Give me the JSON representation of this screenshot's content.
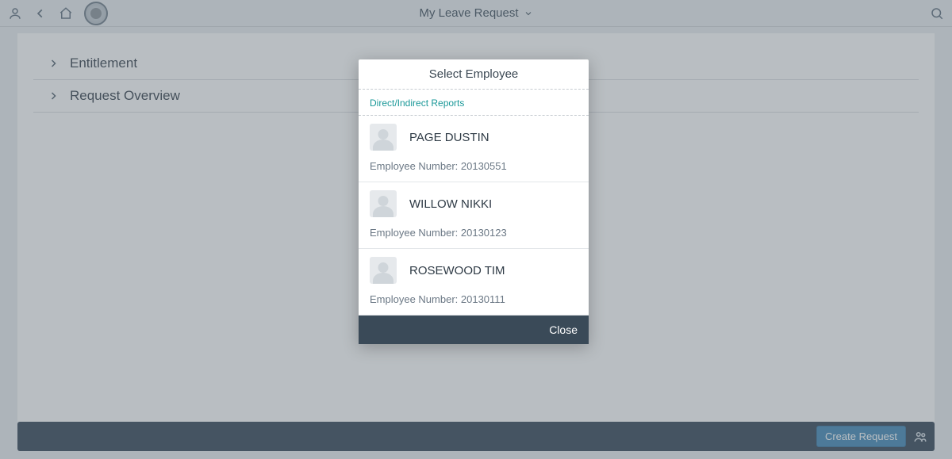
{
  "header": {
    "title": "My Leave Request"
  },
  "accordion": {
    "items": [
      {
        "label": "Entitlement"
      },
      {
        "label": "Request Overview"
      }
    ]
  },
  "footer": {
    "create_label": "Create Request"
  },
  "dialog": {
    "title": "Select Employee",
    "subheader": "Direct/Indirect Reports",
    "emp_number_prefix": "Employee Number: ",
    "employees": [
      {
        "name": "PAGE DUSTIN",
        "number": "20130551"
      },
      {
        "name": "WILLOW NIKKI",
        "number": "20130123"
      },
      {
        "name": "ROSEWOOD TIM",
        "number": "20130111"
      }
    ],
    "close_label": "Close"
  }
}
